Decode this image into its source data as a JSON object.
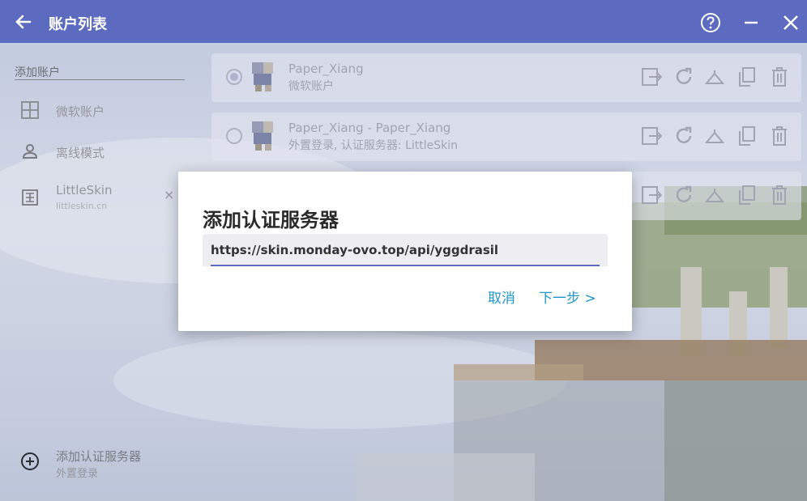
{
  "titlebar": {
    "title": "账户列表",
    "back_icon": "arrow-left-icon",
    "help_icon": "help-circle-icon",
    "minimize_icon": "minimize-icon",
    "close_icon": "close-icon"
  },
  "sidebar": {
    "add_account_label": "添加账户",
    "items": [
      {
        "label": "微软账户",
        "icon": "microsoft-grid-icon"
      },
      {
        "label": "离线模式",
        "icon": "person-icon"
      },
      {
        "label": "LittleSkin",
        "sublabel": "littleskin.cn",
        "icon": "littleskin-icon",
        "remove": "×"
      }
    ],
    "add_auth": {
      "label": "添加认证服务器",
      "sublabel": "外置登录",
      "icon": "plus-circle-icon"
    }
  },
  "accounts": [
    {
      "name": "Paper_Xiang",
      "type": "微软账户",
      "selected": true
    },
    {
      "name": "Paper_Xiang - Paper_Xiang",
      "type": "外置登录, 认证服务器: LittleSkin",
      "selected": false
    },
    {
      "name": "",
      "type": "",
      "selected": false
    }
  ],
  "account_actions": [
    "move-icon",
    "refresh-icon",
    "skin-hanger-icon",
    "copy-icon",
    "delete-icon"
  ],
  "dialog": {
    "title": "添加认证服务器",
    "url_value": "https://skin.monday-ovo.top/api/yggdrasil",
    "cancel_label": "取消",
    "next_label": "下一步 >"
  },
  "colors": {
    "titlebar": "#5c6bc0",
    "accent": "#2196c9"
  }
}
